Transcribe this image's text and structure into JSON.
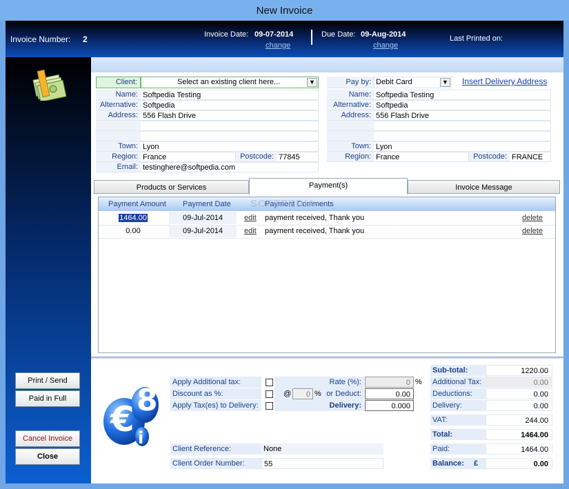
{
  "window": {
    "title": "New Invoice"
  },
  "header": {
    "invoice_number_label": "Invoice Number:",
    "invoice_number": "2",
    "invoice_date_label": "Invoice Date:",
    "invoice_date": "09-07-2014",
    "invoice_date_change": "change",
    "due_date_label": "Due Date:",
    "due_date": "09-Aug-2014",
    "due_date_change": "change",
    "last_printed_label": "Last Printed on:",
    "last_printed_value": ""
  },
  "client": {
    "label": "Client:",
    "select_placeholder": "Select an existing client here...",
    "fields": [
      {
        "label": "Name:",
        "value": "Softpedia Testing"
      },
      {
        "label": "Alternative:",
        "value": "Softpedia"
      },
      {
        "label": "Address:",
        "value": "556 Flash Drive"
      },
      {
        "label": "",
        "value": ""
      },
      {
        "label": "",
        "value": ""
      },
      {
        "label": "Town:",
        "value": "Lyon"
      },
      {
        "label": "Region:",
        "value": "France"
      },
      {
        "label": "Email:",
        "value": "testinghere@softpedia.com"
      }
    ],
    "postcode_label": "Postcode:",
    "postcode": "77845"
  },
  "delivery": {
    "pay_by_label": "Pay by:",
    "pay_by_value": "Debit Card",
    "insert_link": "Insert Delivery Address",
    "fields": [
      {
        "label": "Name:",
        "value": "Softpedia Testing"
      },
      {
        "label": "Alternative:",
        "value": "Softpedia"
      },
      {
        "label": "Address:",
        "value": "556 Flash Drive"
      },
      {
        "label": "",
        "value": ""
      },
      {
        "label": "",
        "value": ""
      },
      {
        "label": "Town:",
        "value": "Lyon"
      },
      {
        "label": "Region:",
        "value": "France"
      }
    ],
    "postcode_label": "Postcode:",
    "postcode": "FRANCE"
  },
  "tabs": [
    "Products or Services",
    "Payment(s)",
    "Invoice Message"
  ],
  "payments": {
    "headers": [
      "Payment Amount",
      "Payment Date",
      "Payment Comments"
    ],
    "rows": [
      {
        "amount": "1464.00",
        "date": "09-Jul-2014",
        "edit": "edit",
        "comment": "payment received, Thank you",
        "delete": "delete"
      },
      {
        "amount": "0.00",
        "date": "09-Jul-2014",
        "edit": "edit",
        "comment": "payment received, Thank you",
        "delete": "delete"
      }
    ]
  },
  "watermark": "SOFTPEDIA",
  "sidebar": {
    "print_send": "Print / Send",
    "paid_in_full": "Paid in Full",
    "cancel_invoice": "Cancel  Invoice",
    "close": "Close"
  },
  "tax": {
    "apply_additional_tax": "Apply Additional tax:",
    "discount_as_percent": "Discount as %:",
    "apply_tax_delivery": "Apply Tax(es) to Delivery:",
    "at": "@",
    "discount_value": "0",
    "percent": "%",
    "rate_label": "Rate (%):",
    "rate_value": "0",
    "or_deduct_label": "or Deduct:",
    "deduct_value": "0.00",
    "delivery_label": "Delivery:",
    "delivery_value": "0.000"
  },
  "references": {
    "client_reference_label": "Client Reference:",
    "client_reference": "None",
    "client_order_label": "Client Order Number:",
    "client_order": "55"
  },
  "totals": {
    "subtotal_label": "Sub-total:",
    "subtotal": "1220.00",
    "additional_tax_label": "Additional Tax:",
    "additional_tax": "0.00",
    "deductions_label": "Deductions:",
    "deductions": "0.00",
    "delivery_label": "Delivery:",
    "delivery": "0.00",
    "vat_label": "VAT:",
    "vat": "244.00",
    "total_label": "Total:",
    "total": "1464.00",
    "paid_label": "Paid:",
    "paid": "1464.00",
    "balance_label": "Balance:",
    "currency": "£",
    "balance": "0.00"
  },
  "logo_text": "€",
  "logo_digit": "8",
  "logo_letter": "i"
}
